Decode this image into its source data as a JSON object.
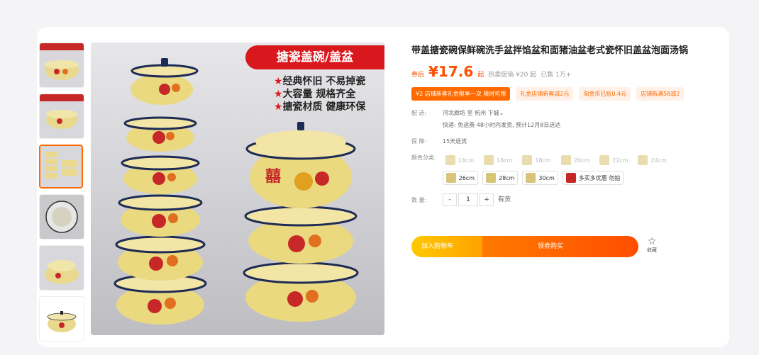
{
  "product": {
    "title": "带盖搪瓷碗保鲜碗洗手盆拌馅盆和面猪油盆老式瓷怀旧盖盆泡面汤锅",
    "price_prefix": "券后",
    "price": "¥17.6",
    "price_suffix": "起",
    "original_price": "热卖促销 ¥20 起",
    "sold": "已售 1万+"
  },
  "image_banner": {
    "title": "搪瓷盖碗/盖盆",
    "features": [
      "经典怀旧  不易掉瓷",
      "大容量 规格齐全",
      "搪瓷材质 健康环保"
    ],
    "feature_bullet": "★"
  },
  "coupons": [
    "¥2  店铺新客礼金限享一次 限时可用",
    "礼金店铺新客减2元",
    "淘金币已抵0.4元",
    "店铺新满58减2"
  ],
  "shipping": {
    "label": "配  送:",
    "from": "河北廊坊",
    "to_word": "至",
    "to": "杭州 下城",
    "detail": "快递: 免运费  48小时内发货, 预计12月8日送达"
  },
  "guarantee": {
    "label": "保  障:",
    "value": "15天退货"
  },
  "colors": {
    "label": "颜色分类:",
    "options_disabled": [
      "14cm",
      "16cm",
      "18cm",
      "20cm",
      "22cm",
      "24cm"
    ],
    "options_enabled": [
      "26cm",
      "28cm",
      "30cm",
      "多买多优惠 勿拍"
    ]
  },
  "quantity": {
    "label": "数  量:",
    "minus": "-",
    "value": "1",
    "plus": "+",
    "status": "有货"
  },
  "actions": {
    "cart": "加入购物车",
    "buy": "领券购买",
    "fav_icon": "☆",
    "fav": "收藏"
  },
  "accent": "#ff5000"
}
